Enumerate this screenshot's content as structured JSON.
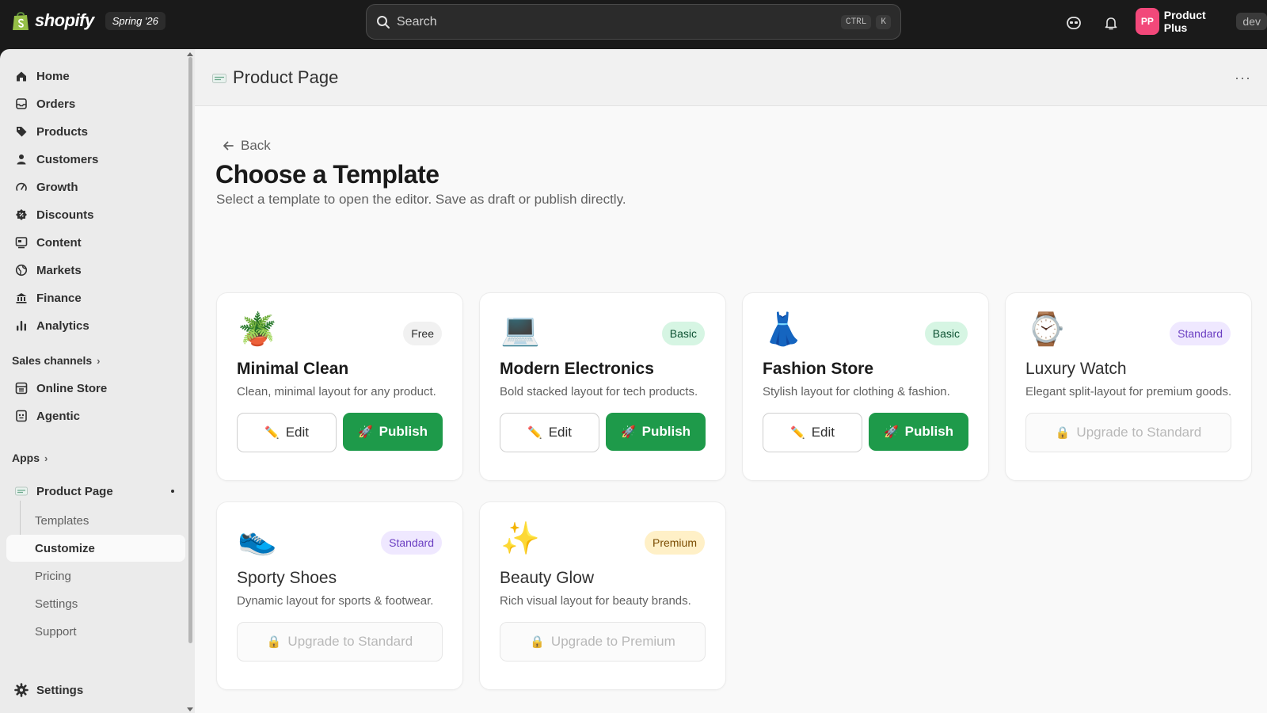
{
  "topbar": {
    "logo_text": "shopify",
    "edition": "Spring '26",
    "search_placeholder": "Search",
    "shortcut_keys": [
      "CTRL",
      "K"
    ],
    "account_initials": "PP",
    "account_name": "Product Plus",
    "env_badge": "dev"
  },
  "sidebar": {
    "items": [
      {
        "label": "Home",
        "icon": "home-icon"
      },
      {
        "label": "Orders",
        "icon": "orders-icon"
      },
      {
        "label": "Products",
        "icon": "tag-icon"
      },
      {
        "label": "Customers",
        "icon": "person-icon"
      },
      {
        "label": "Growth",
        "icon": "gauge-icon"
      },
      {
        "label": "Discounts",
        "icon": "discount-icon"
      },
      {
        "label": "Content",
        "icon": "content-icon"
      },
      {
        "label": "Markets",
        "icon": "globe-icon"
      },
      {
        "label": "Finance",
        "icon": "bank-icon"
      },
      {
        "label": "Analytics",
        "icon": "bar-chart-icon"
      }
    ],
    "sales_channels_label": "Sales channels",
    "channels": [
      {
        "label": "Online Store",
        "icon": "store-icon"
      },
      {
        "label": "Agentic",
        "icon": "agentic-icon"
      }
    ],
    "apps_label": "Apps",
    "app": {
      "label": "Product Page",
      "subitems": [
        "Templates",
        "Customize",
        "Pricing",
        "Settings",
        "Support"
      ],
      "active_subitem": "Customize"
    },
    "settings_label": "Settings"
  },
  "app_header": {
    "title": "Product Page",
    "more": "···"
  },
  "page": {
    "back": "Back",
    "title": "Choose a Template",
    "subtitle": "Select a template to open the editor. Save as draft or publish directly."
  },
  "templates": [
    {
      "emoji": "🪴",
      "name": "Minimal Clean",
      "badge": "Free",
      "tier": "free",
      "desc": "Clean, minimal layout for any product.",
      "locked": false,
      "edit": "Edit",
      "publish": "Publish"
    },
    {
      "emoji": "💻",
      "name": "Modern Electronics",
      "badge": "Basic",
      "tier": "basic",
      "desc": "Bold stacked layout for tech products.",
      "locked": false,
      "edit": "Edit",
      "publish": "Publish"
    },
    {
      "emoji": "👗",
      "name": "Fashion Store",
      "badge": "Basic",
      "tier": "basic",
      "desc": "Stylish layout for clothing & fashion.",
      "locked": false,
      "edit": "Edit",
      "publish": "Publish"
    },
    {
      "emoji": "⌚",
      "name": "Luxury Watch",
      "badge": "Standard",
      "tier": "standard",
      "desc": "Elegant split-layout for premium goods.",
      "locked": true,
      "upgrade": "Upgrade to Standard"
    },
    {
      "emoji": "👟",
      "name": "Sporty Shoes",
      "badge": "Standard",
      "tier": "standard",
      "desc": "Dynamic layout for sports & footwear.",
      "locked": true,
      "upgrade": "Upgrade to Standard"
    },
    {
      "emoji": "✨",
      "name": "Beauty Glow",
      "badge": "Premium",
      "tier": "premium",
      "desc": "Rich visual layout for beauty brands.",
      "locked": true,
      "upgrade": "Upgrade to Premium"
    }
  ],
  "icons": {
    "edit": "✏️",
    "publish": "🚀",
    "lock": "🔒"
  },
  "colors": {
    "topbar_bg": "#1a1a1a",
    "publish_green": "#1e9a4a",
    "avatar_pink": "#f2487a"
  }
}
